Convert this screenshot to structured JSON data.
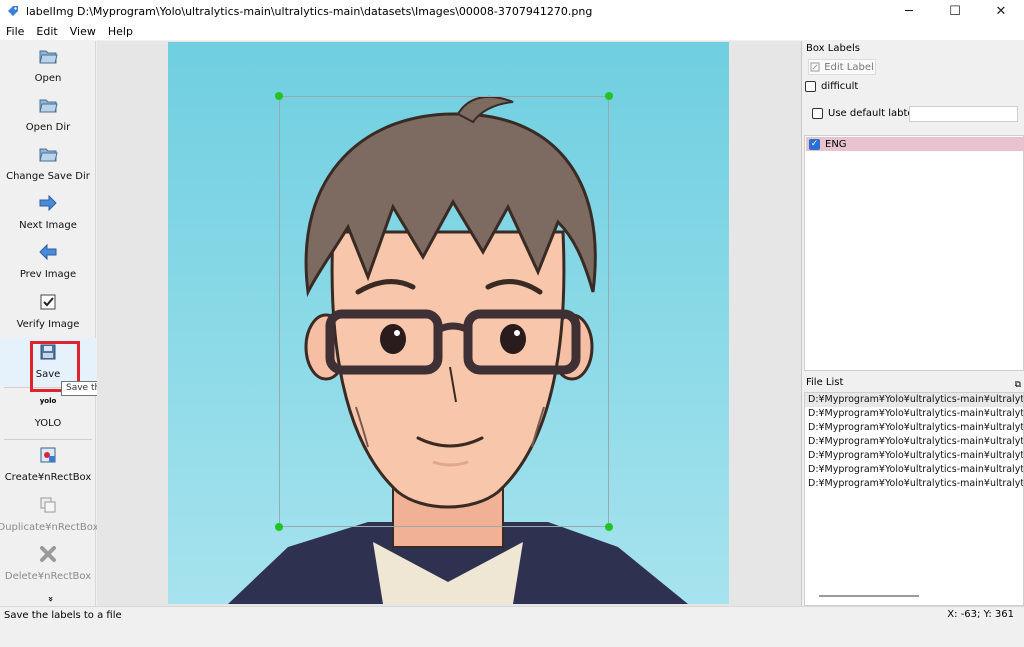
{
  "window": {
    "title": "labelImg D:\\Myprogram\\Yolo\\ultralytics-main\\ultralytics-main\\datasets\\Images\\00008-3707941270.png",
    "minimize_glyph": "─",
    "maximize_glyph": "☐",
    "close_glyph": "✕"
  },
  "menu": [
    "File",
    "Edit",
    "View",
    "Help"
  ],
  "toolbar": {
    "open": "Open",
    "open_dir": "Open Dir",
    "change_save_dir": "Change Save Dir",
    "next_image": "Next Image",
    "prev_image": "Prev Image",
    "verify_image": "Verify Image",
    "save": "Save",
    "format_icon_text": "yolo",
    "format": "YOLO",
    "create_rect": "Create¥nRectBox",
    "duplicate_rect": "Duplicate¥nRectBox",
    "delete_rect": "Delete¥nRectBox",
    "more_glyph": "»"
  },
  "tooltip": "Save the labels to a file",
  "box_labels": {
    "title": "Box Labels",
    "edit_label": "Edit Label",
    "difficult": "difficult",
    "use_default_label": "Use default labtel",
    "default_label_value": "",
    "labels": [
      {
        "name": "ENG",
        "checked": true,
        "color": "#e7c3cb"
      }
    ]
  },
  "file_list": {
    "title": "File List",
    "items": [
      "D:¥Myprogram¥Yolo¥ultralytics-main¥ultralytics-m",
      "D:¥Myprogram¥Yolo¥ultralytics-main¥ultralytics-m",
      "D:¥Myprogram¥Yolo¥ultralytics-main¥ultralytics-m",
      "D:¥Myprogram¥Yolo¥ultralytics-main¥ultralytics-m",
      "D:¥Myprogram¥Yolo¥ultralytics-main¥ultralytics-m",
      "D:¥Myprogram¥Yolo¥ultralytics-main¥ultralytics-m",
      "D:¥Myprogram¥Yolo¥ultralytics-main¥ultralytics-m"
    ]
  },
  "status": {
    "message": "Save the labels to a file",
    "coords": "X: -63; Y: 361"
  },
  "colors": {
    "highlight": "#e0242d",
    "handle": "#22c322",
    "label_bg": "#e7c3cb"
  }
}
